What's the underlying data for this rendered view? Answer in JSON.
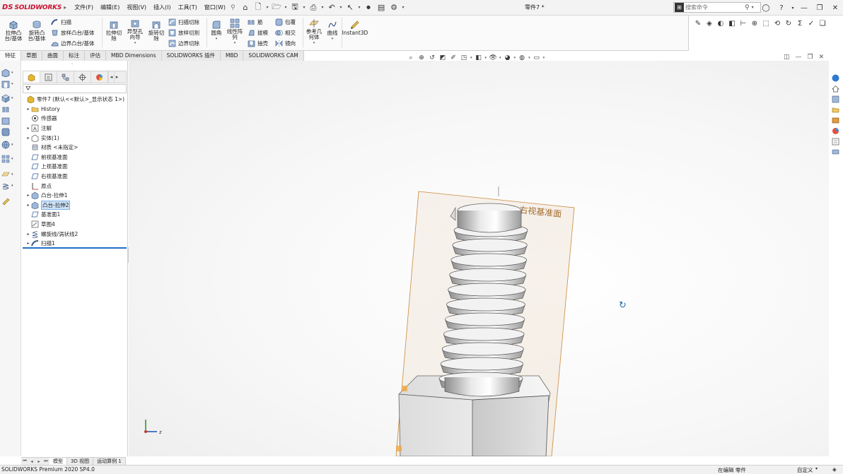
{
  "app": {
    "brand_ds": "DS",
    "brand_name": "SOLIDWORKS",
    "document_title": "零件7 *",
    "search_placeholder": "搜索命令"
  },
  "menus": [
    "文件(F)",
    "编辑(E)",
    "视图(V)",
    "插入(I)",
    "工具(T)",
    "窗口(W)"
  ],
  "command_manager": {
    "large": [
      {
        "name": "extruded-boss",
        "label": "拉伸凸\n台/基体"
      },
      {
        "name": "revolved-boss",
        "label": "旋转凸\n台/基体"
      },
      {
        "name": "extruded-cut",
        "label": "拉伸切\n除"
      },
      {
        "name": "hole-wizard",
        "label": "异型孔\n向导"
      },
      {
        "name": "revolved-cut",
        "label": "旋转切\n除"
      },
      {
        "name": "fillet",
        "label": "圆角"
      },
      {
        "name": "linear-pattern",
        "label": "线性阵\n列"
      },
      {
        "name": "reference-geometry",
        "label": "参考几\n何体"
      },
      {
        "name": "curves",
        "label": "曲线"
      },
      {
        "name": "instant3d",
        "label": "Instant3D"
      }
    ],
    "small": {
      "sweep": "扫描",
      "loft": "放样凸台/基体",
      "boundary": "边界凸台/基体",
      "swept_cut": "扫描切除",
      "lofted_cut": "放样切割",
      "boundary_cut": "边界切除",
      "rib": "筋",
      "draft": "拔模",
      "shell": "抽壳",
      "wrap": "包覆",
      "intersect": "相交",
      "mirror": "镜向"
    }
  },
  "tabs": [
    "特征",
    "草图",
    "曲面",
    "标注",
    "评估",
    "MBD Dimensions",
    "SOLIDWORKS 插件",
    "MBD",
    "SOLIDWORKS CAM"
  ],
  "feature_tree": {
    "root": "零件7 (默认<<默认>_显示状态 1>)",
    "items": [
      {
        "label": "History",
        "expand": true,
        "icon": "folder"
      },
      {
        "label": "传感器",
        "expand": false,
        "icon": "sensor"
      },
      {
        "label": "注解",
        "expand": true,
        "icon": "annotation"
      },
      {
        "label": "实体(1)",
        "expand": true,
        "icon": "solid"
      },
      {
        "label": "材质 <未指定>",
        "expand": false,
        "icon": "material"
      },
      {
        "label": "前视基准面",
        "expand": false,
        "icon": "plane"
      },
      {
        "label": "上视基准面",
        "expand": false,
        "icon": "plane"
      },
      {
        "label": "右视基准面",
        "expand": false,
        "icon": "plane"
      },
      {
        "label": "原点",
        "expand": false,
        "icon": "origin"
      },
      {
        "label": "凸台-拉伸1",
        "expand": true,
        "icon": "extrude"
      },
      {
        "label": "凸台-拉伸2",
        "expand": true,
        "icon": "extrude",
        "selected": true
      },
      {
        "label": "基准面1",
        "expand": false,
        "icon": "plane"
      },
      {
        "label": "草图4",
        "expand": false,
        "icon": "sketch"
      },
      {
        "label": "螺旋线/涡状线2",
        "expand": true,
        "icon": "helix"
      },
      {
        "label": "扫描1",
        "expand": true,
        "icon": "sweep"
      }
    ]
  },
  "viewport": {
    "plane_label": "右视基准面",
    "triad_axis": "z"
  },
  "bottom_tabs": [
    "模型",
    "3D 视图",
    "运动算例 1"
  ],
  "status": {
    "product": "SOLIDWORKS Premium 2020 SP4.0",
    "mode": "在编辑 零件",
    "custom": "自定义"
  },
  "colors": {
    "brand_red": "#c8102e",
    "selection_blue": "#cde3f8",
    "rollback_blue": "#1f6fc8",
    "plane_orange": "#c98a3b"
  }
}
